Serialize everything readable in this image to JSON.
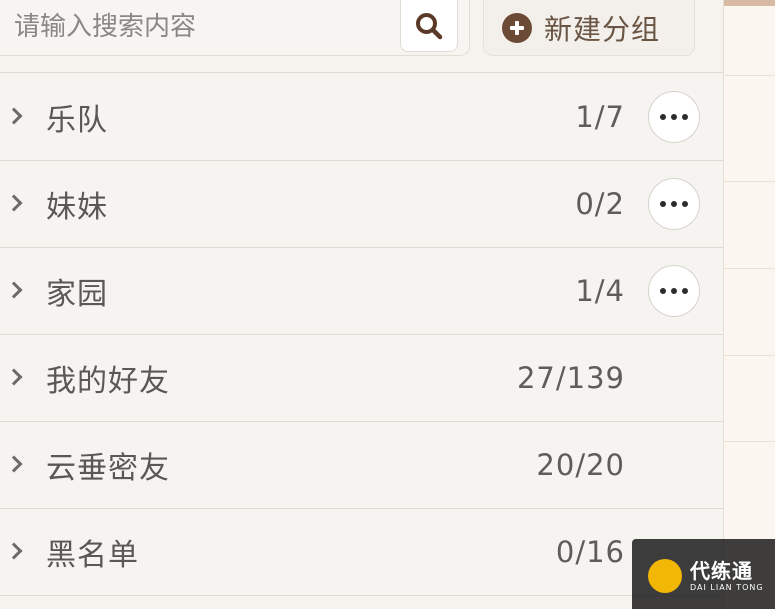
{
  "search": {
    "placeholder": "请输入搜索内容"
  },
  "toolbar": {
    "new_group_label": "新建分组"
  },
  "groups": [
    {
      "name": "乐队",
      "count": "1/7",
      "has_more": true
    },
    {
      "name": "妹妹",
      "count": "0/2",
      "has_more": true
    },
    {
      "name": "家园",
      "count": "1/4",
      "has_more": true
    },
    {
      "name": "我的好友",
      "count": "27/139",
      "has_more": false
    },
    {
      "name": "云垂密友",
      "count": "20/20",
      "has_more": false
    },
    {
      "name": "黑名单",
      "count": "0/16",
      "has_more": false
    }
  ],
  "watermark": {
    "title": "代练通",
    "subtitle": "DAI LIAN TONG"
  },
  "icons": {
    "search": "search-icon",
    "add": "plus-circle-icon",
    "expand": "chevron-right-icon",
    "more": "more-dots-icon"
  },
  "colors": {
    "accent": "#6b4a36",
    "background": "#f6f3ee"
  }
}
